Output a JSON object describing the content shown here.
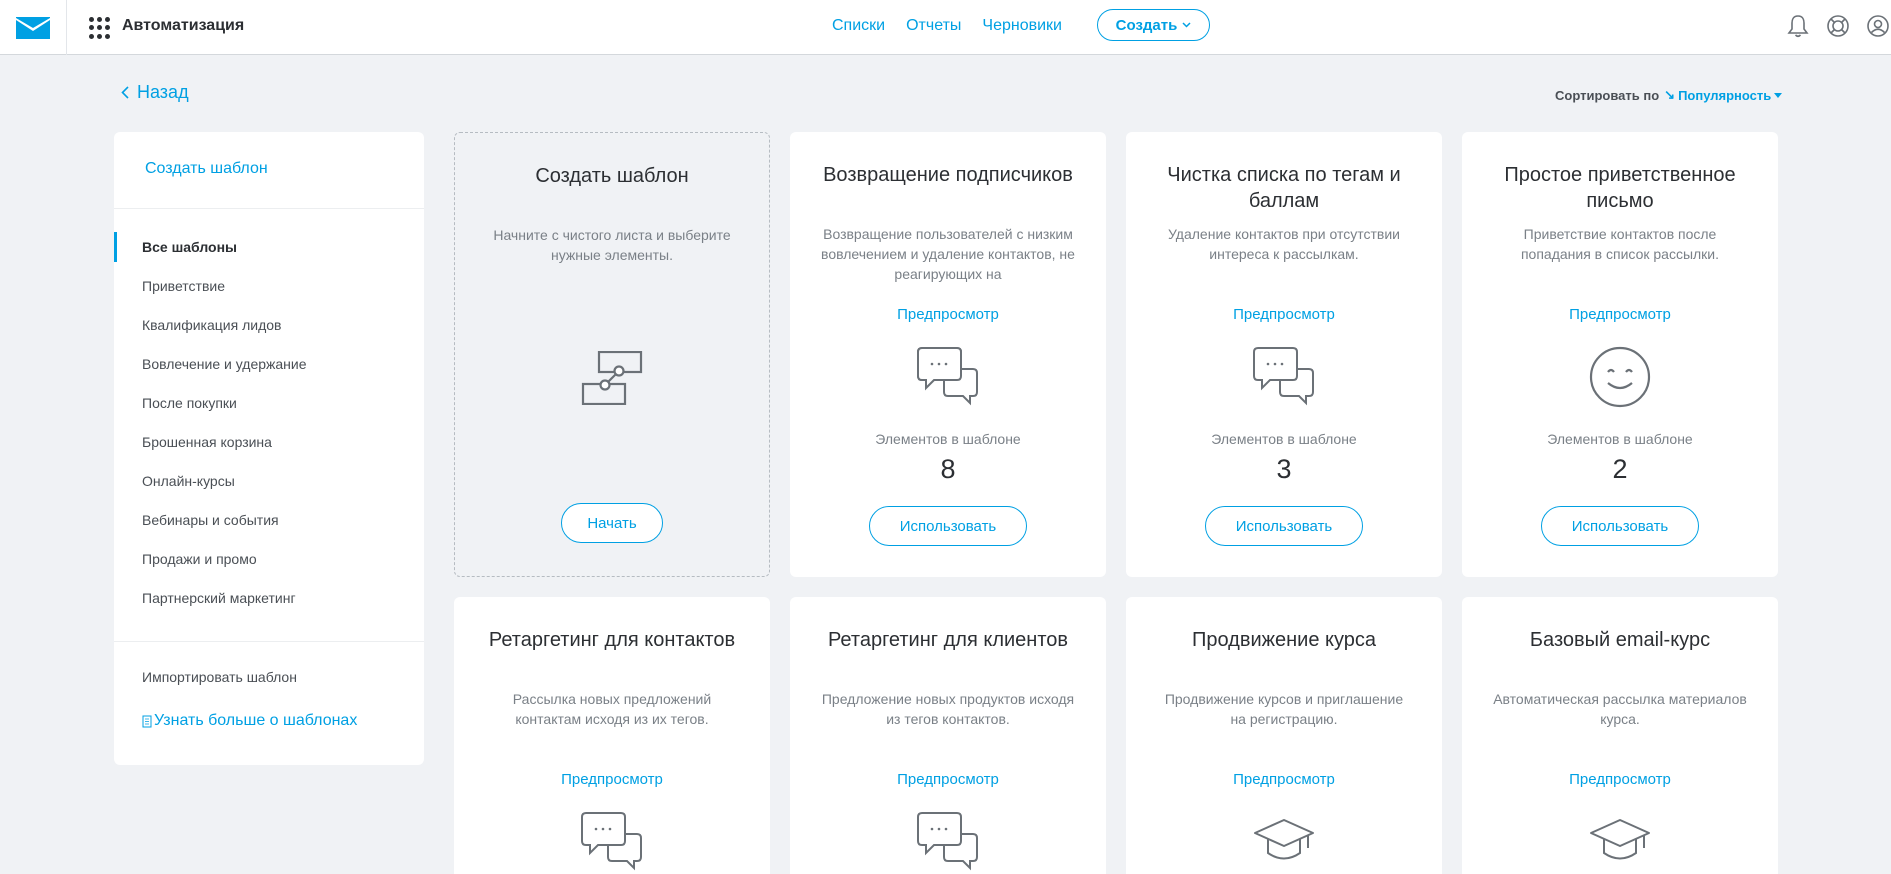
{
  "topbar": {
    "app_title": "Автоматизация",
    "nav": [
      "Списки",
      "Отчеты",
      "Черновики"
    ],
    "create_label": "Создать",
    "icons": [
      "bell-icon",
      "lifebuoy-icon",
      "user-icon"
    ]
  },
  "back_label": "Назад",
  "sort": {
    "label": "Сортировать по",
    "value": "Популярность"
  },
  "sidebar": {
    "create_template": "Создать шаблон",
    "categories": [
      "Все шаблоны",
      "Приветствие",
      "Квалификация лидов",
      "Вовлечение и удержание",
      "После покупки",
      "Брошенная корзина",
      "Онлайн-курсы",
      "Вебинары и события",
      "Продажи и промо",
      "Партнерский маркетинг"
    ],
    "active_category": "Все шаблоны",
    "import_template": "Импортировать шаблон",
    "learn_more": "Узнать больше о шаблонах"
  },
  "cards": [
    {
      "title": "Создать шаблон",
      "desc": "Начните с чистого листа и выберите нужные элементы.",
      "icon": "workflow-icon",
      "button": "Начать"
    },
    {
      "title": "Возвращение подписчиков",
      "desc": "Возвращение пользователей с низким вовлечением и удаление контактов, не реагирующих на",
      "preview": "Предпросмотр",
      "icon": "chat-bubbles-icon",
      "count_label": "Элементов в шаблоне",
      "count": "8",
      "button": "Использовать"
    },
    {
      "title": "Чистка списка по тегам и баллам",
      "desc": "Удаление контактов при отсутствии интереса к рассылкам.",
      "preview": "Предпросмотр",
      "icon": "chat-bubbles-icon",
      "count_label": "Элементов в шаблоне",
      "count": "3",
      "button": "Использовать"
    },
    {
      "title": "Простое приветственное письмо",
      "desc": "Приветствие контактов после попадания в список рассылки.",
      "preview": "Предпросмотр",
      "icon": "smile-icon",
      "count_label": "Элементов в шаблоне",
      "count": "2",
      "button": "Использовать"
    },
    {
      "title": "Ретаргетинг для контактов",
      "desc": "Рассылка новых предложений контактам исходя из их тегов.",
      "preview": "Предпросмотр",
      "icon": "chat-bubbles-icon"
    },
    {
      "title": "Ретаргетинг для клиентов",
      "desc": "Предложение новых продуктов исходя из тегов контактов.",
      "preview": "Предпросмотр",
      "icon": "chat-bubbles-icon"
    },
    {
      "title": "Продвижение курса",
      "desc": "Продвижение курсов и приглашение на регистрацию.",
      "preview": "Предпросмотр",
      "icon": "graduation-cap-icon"
    },
    {
      "title": "Базовый email-курс",
      "desc": "Автоматическая рассылка материалов курса.",
      "preview": "Предпросмотр",
      "icon": "graduation-cap-icon"
    }
  ]
}
